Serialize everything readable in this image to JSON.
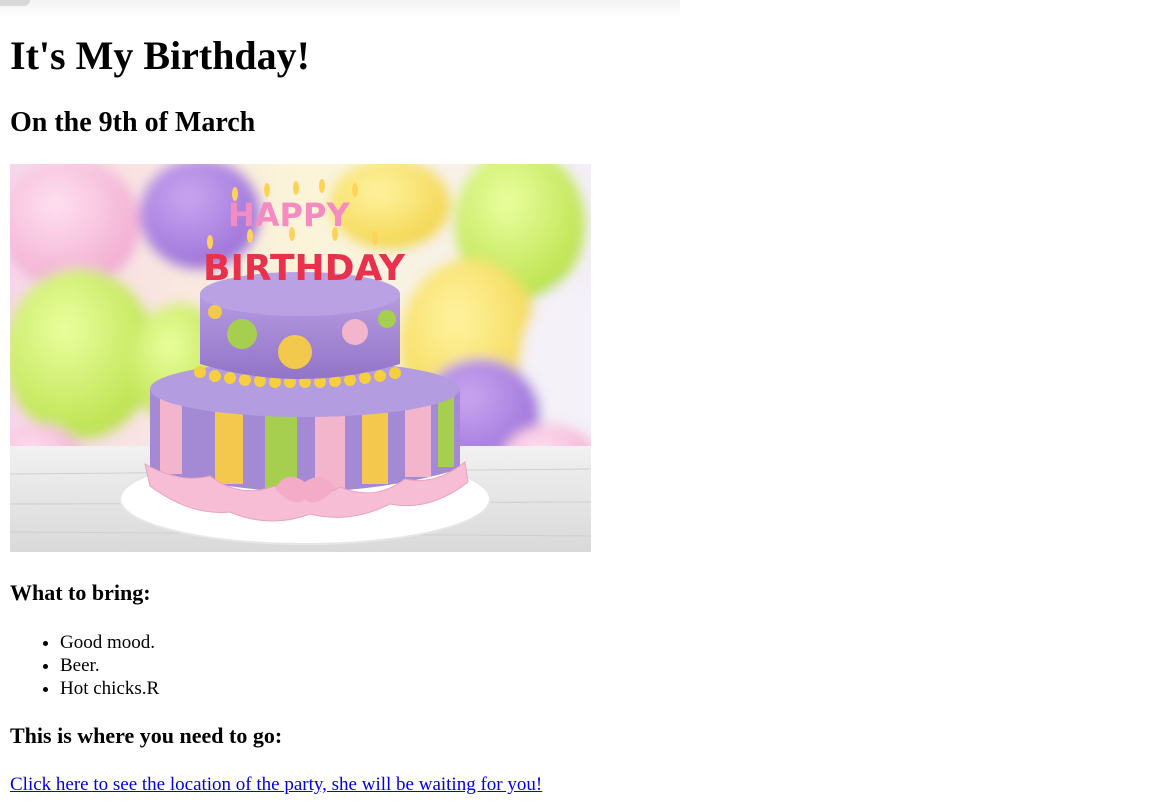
{
  "page": {
    "title": "It's My Birthday!",
    "subtitle": "On the 9th of March"
  },
  "image": {
    "alt": "Birthday cake with Happy Birthday candles and balloons",
    "candle_line1": "HAPPY",
    "candle_line2": "BIRTHDAY"
  },
  "bring": {
    "heading": "What to bring:",
    "items": [
      "Good mood.",
      "Beer.",
      "Hot chicks.R"
    ]
  },
  "location": {
    "heading": "This is where you need to go:",
    "link_text": "Click here to see the location of the party, she will be waiting for you!"
  },
  "colors": {
    "link": "#0000ee",
    "cake_purple": "#a98ad6",
    "cake_pink": "#f3b5cc",
    "cake_yellow": "#f2c94c",
    "cake_green": "#a6cf4f"
  }
}
